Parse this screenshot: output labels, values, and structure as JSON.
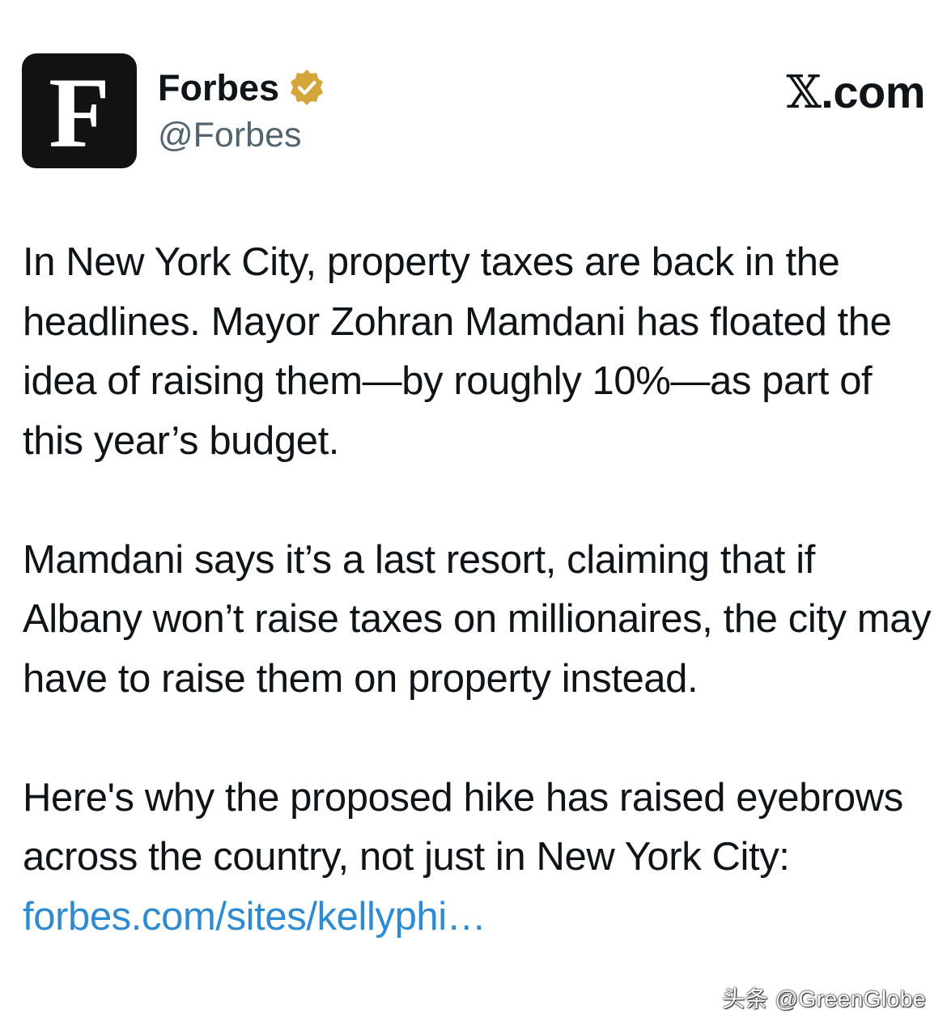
{
  "account": {
    "avatar_letter": "F",
    "display_name": "Forbes",
    "handle": "@Forbes",
    "verified_badge_color": "#d4a63a",
    "verified_icon": "gold-checkmark-badge"
  },
  "brand": {
    "x_glyph": "𝕏",
    "domain": ".com"
  },
  "post": {
    "paragraph_1": "In New York City, property taxes are back in the headlines. Mayor Zohran Mamdani has floated the idea of raising them—by roughly 10%—as part of this year’s budget.",
    "paragraph_2": "Mamdani says it’s a last resort, claiming that if Albany won’t raise taxes on millionaires, the city may have to raise them on property instead.",
    "paragraph_3_text": "Here's why the proposed hike has raised eyebrows across the country, not just in New York City: ",
    "paragraph_3_link": "forbes.com/sites/kellyphi…",
    "link_color": "#2f8bd1"
  },
  "watermark": {
    "text": "头条 @GreenGlobe"
  }
}
